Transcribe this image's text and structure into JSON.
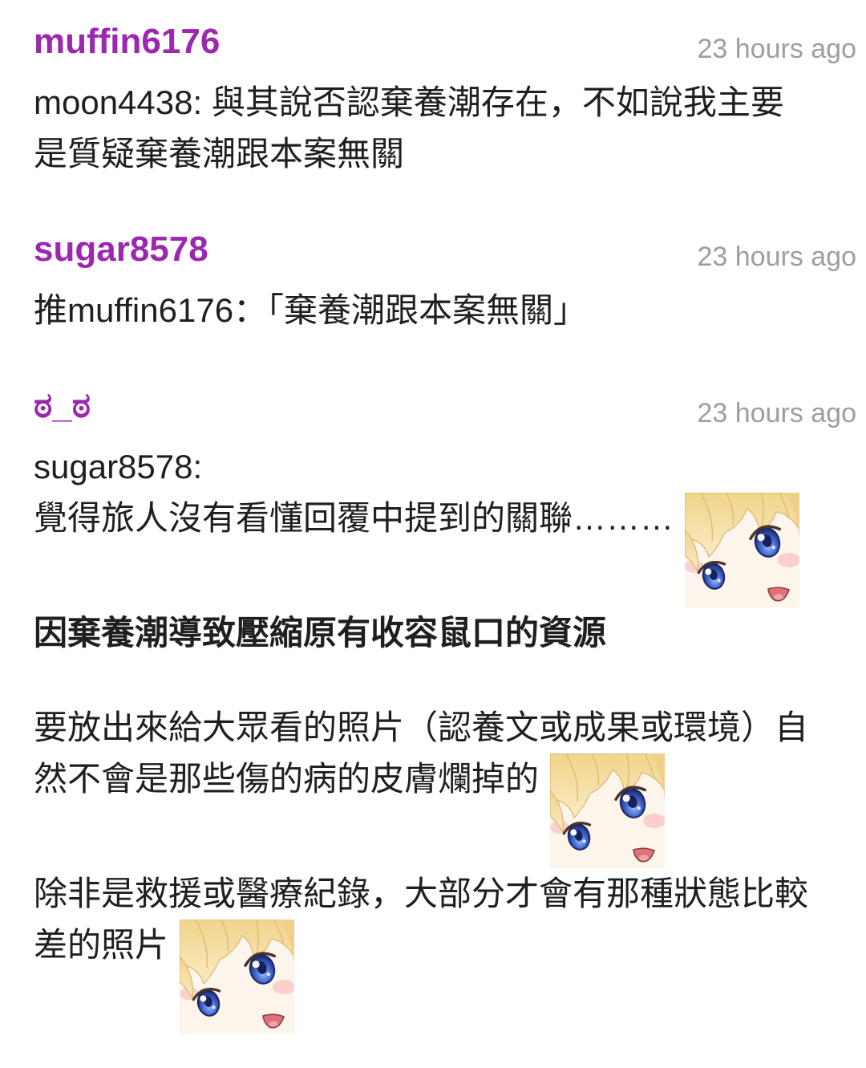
{
  "colors": {
    "username": "#9c27b0",
    "timestamp": "#9e9e9e",
    "text": "#1f1f1f",
    "background": "#ffffff"
  },
  "comments": [
    {
      "username": "muffin6176",
      "time": "23 hours ago",
      "body": [
        {
          "text": "moon4438: 與其說否認棄養潮存在，不如說我主要是質疑棄養潮跟本案無關"
        }
      ]
    },
    {
      "username": "sugar8578",
      "time": "23 hours ago",
      "body": [
        {
          "text": "推muffin6176：「棄養潮跟本案無關」"
        }
      ]
    },
    {
      "username": "ಠ_ಠ",
      "time": "23 hours ago",
      "body": [
        {
          "text": "sugar8578:"
        },
        {
          "text": "覺得旅人沒有看懂回覆中提到的關聯………",
          "sticker": "anime-girl-face-sticker"
        },
        {
          "text": "因棄養潮導致壓縮原有收容鼠口的資源"
        },
        {
          "text": "要放出來給大眾看的照片（認養文或成果或環境）自然不會是那些傷的病的皮膚爛掉的",
          "sticker": "anime-girl-face-sticker"
        },
        {
          "text": "除非是救援或醫療紀錄，大部分才會有那種狀態比較差的照片",
          "sticker": "anime-girl-face-sticker"
        }
      ]
    }
  ]
}
